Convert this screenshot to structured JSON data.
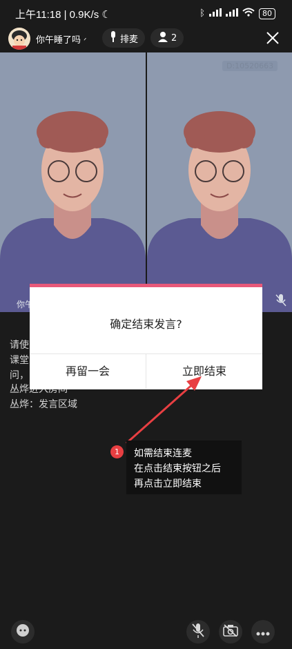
{
  "status_bar": {
    "time": "上午11:18",
    "speed": "0.9K/s",
    "battery": "80"
  },
  "header": {
    "room_name": "你午睡了吗",
    "queue_label": "排麦",
    "member_count": "2"
  },
  "video": {
    "room_id": "D:10520663",
    "left_name": "你午"
  },
  "chat": {
    "lines": [
      "请使",
      "课堂",
      "问，",
      "丛烨进入房间",
      "丛烨：发言区域"
    ]
  },
  "dialog": {
    "title": "确定结束发言?",
    "stay_button": "再留一会",
    "end_button": "立即结束"
  },
  "annotation": {
    "badge": "1",
    "lines": [
      "如需结束连麦",
      "在点击结束按钮之后",
      "再点击立即结束"
    ],
    "color": "#e83f42"
  },
  "colors": {
    "accent": "#e8597a",
    "video_bg": "#8e9aaf"
  }
}
